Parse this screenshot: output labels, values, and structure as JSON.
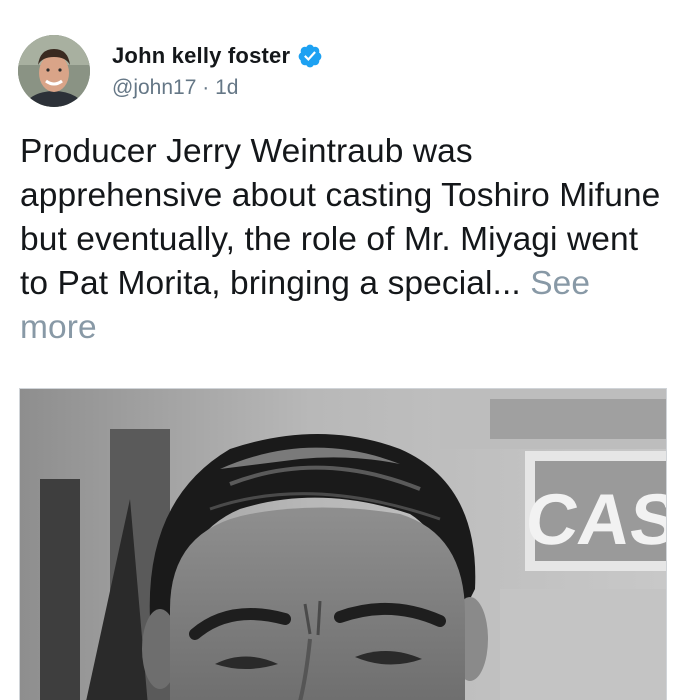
{
  "tweet": {
    "author": {
      "display_name": "John kelly foster",
      "handle": "@john17",
      "verified": true,
      "verified_icon": "verified-badge-icon",
      "verified_color": "#1da1f2"
    },
    "separator": "·",
    "timestamp": "1d",
    "text": "Producer Jerry Weintraub was apprehensive about casting Toshiro Mifune but eventually, the role of Mr. Miyagi went to Pat Morita, bringing a special...",
    "see_more_label": "See more",
    "media": {
      "sign_text": "CAS"
    }
  },
  "colors": {
    "name": "#14171a",
    "secondary": "#657786",
    "see_more": "#8899a6",
    "accent": "#1da1f2"
  }
}
